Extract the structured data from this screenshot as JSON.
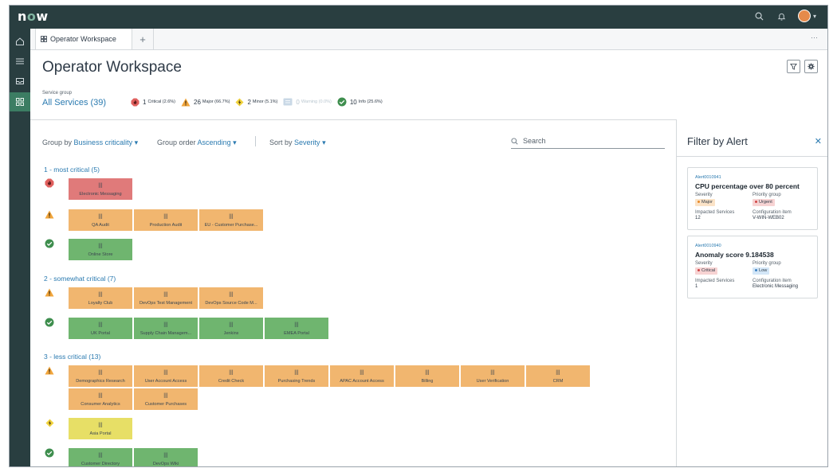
{
  "app": {
    "logo": "now"
  },
  "tabs": [
    {
      "label": "Operator Workspace"
    }
  ],
  "header": {
    "title": "Operator Workspace",
    "service_group_label": "Service group",
    "service_group_value": "All Services (39)"
  },
  "summary": [
    {
      "n": "1",
      "t": "Critical (2.6%)"
    },
    {
      "n": "26",
      "t": "Major (66.7%)"
    },
    {
      "n": "2",
      "t": "Minor (5.1%)"
    },
    {
      "n": "0",
      "t": "Warning (0.0%)"
    },
    {
      "n": "10",
      "t": "Info (25.6%)"
    }
  ],
  "controls": {
    "group_by_label": "Group by",
    "group_by_value": "Business criticality",
    "group_order_label": "Group order",
    "group_order_value": "Ascending",
    "sort_by_label": "Sort by",
    "sort_by_value": "Severity",
    "search_placeholder": "Search"
  },
  "groups": [
    {
      "heading": "1 - most critical (5)",
      "rows": [
        {
          "severity": "critical",
          "tiles": [
            "Electronic Messaging"
          ]
        },
        {
          "severity": "major",
          "tiles": [
            "QA Audit",
            "Production Audit",
            "EU - Customer Purchase..."
          ]
        },
        {
          "severity": "ok",
          "tiles": [
            "Online Store"
          ]
        }
      ]
    },
    {
      "heading": "2 - somewhat critical (7)",
      "rows": [
        {
          "severity": "major",
          "tiles": [
            "Loyalty Club",
            "DevOps Test Management",
            "DevOps Source Code M..."
          ]
        },
        {
          "severity": "ok",
          "tiles": [
            "UK Portal",
            "Supply Chain Managem...",
            "Jenkins",
            "EMEA Portal"
          ]
        }
      ]
    },
    {
      "heading": "3 - less critical (13)",
      "rows": [
        {
          "severity": "major",
          "tiles": [
            "Demographics Research",
            "User Account Access",
            "Credit Check",
            "Purchasing Trends",
            "APAC Account Access",
            "Billing",
            "User Verification",
            "CRM",
            "Consumer Analytics",
            "Customer Purchases"
          ]
        },
        {
          "severity": "minor",
          "tiles": [
            "Asia Portal"
          ]
        },
        {
          "severity": "ok",
          "tiles": [
            "Customer Directory",
            "DevOps Wiki"
          ]
        }
      ]
    }
  ],
  "filter_panel": {
    "title": "Filter by Alert",
    "cards": [
      {
        "number": "Alert0010941",
        "title": "CPU percentage over 80 percent",
        "severity_label": "Severity",
        "severity_value": "Major",
        "priority_label": "Priority group",
        "priority_value": "Urgent",
        "impacted_label": "Impacted Services",
        "impacted_value": "12",
        "ci_label": "Configuration item",
        "ci_value": "V-WIN-WEB02"
      },
      {
        "number": "Alert0010940",
        "title": "Anomaly score 9.184538",
        "severity_label": "Severity",
        "severity_value": "Critical",
        "priority_label": "Priority group",
        "priority_value": "Low",
        "impacted_label": "Impacted Services",
        "impacted_value": "1",
        "ci_label": "Configuration item",
        "ci_value": "Electronic Messaging"
      }
    ]
  },
  "colors": {
    "topbar": "#293e40",
    "critical": "#e07a7a",
    "major": "#f1b66f",
    "ok": "#6fb56f",
    "minor": "#e7df66",
    "link": "#2a7ab0"
  }
}
